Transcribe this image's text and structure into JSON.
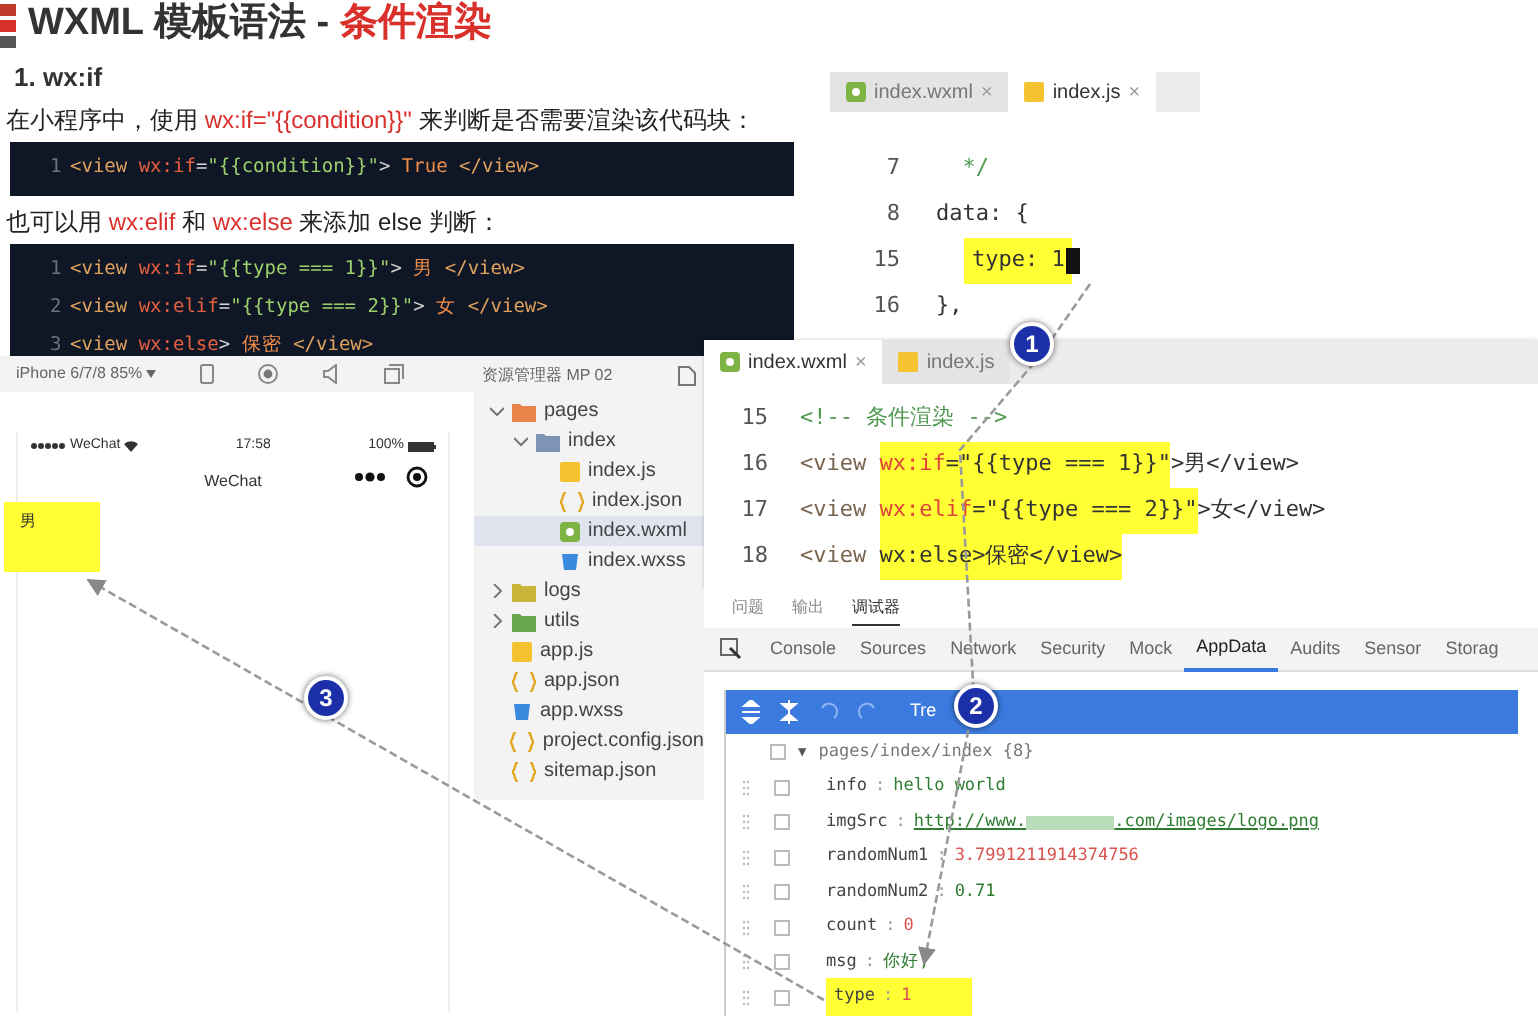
{
  "heading": {
    "title": "WXML 模板语法 - ",
    "highlight": "条件渲染"
  },
  "section_title": "1. wx:if",
  "blocks": [
    {
      "kind": "text",
      "parts": [
        {
          "kind": "plain",
          "text": "在小程序中，使用 "
        },
        {
          "kind": "code",
          "text": "wx:if=\"{{condition}}\""
        },
        {
          "kind": "plain",
          "text": " 来判断是否需要渲染该代码块："
        }
      ]
    },
    {
      "kind": "code",
      "lines": [
        {
          "number": "1",
          "tokens": [
            {
              "kind": "tag",
              "text": "<view"
            },
            {
              "kind": "attr",
              "text": " wx:if"
            },
            {
              "kind": "punct",
              "text": "="
            },
            {
              "kind": "str",
              "text": "\"{{condition}}\""
            },
            {
              "kind": "punct",
              "text": ">"
            },
            {
              "kind": "text",
              "text": " True "
            },
            {
              "kind": "tag",
              "text": "</view>"
            }
          ]
        }
      ]
    },
    {
      "kind": "text",
      "parts": [
        {
          "kind": "plain",
          "text": "也可以用 "
        },
        {
          "kind": "code",
          "text": "wx:elif"
        },
        {
          "kind": "plain",
          "text": " 和 "
        },
        {
          "kind": "code",
          "text": "wx:else"
        },
        {
          "kind": "plain",
          "text": " 来添加 else 判断："
        }
      ]
    },
    {
      "kind": "code",
      "lines": [
        {
          "number": "1",
          "tokens": [
            {
              "kind": "tag",
              "text": "<view"
            },
            {
              "kind": "attr",
              "text": " wx:if"
            },
            {
              "kind": "punct",
              "text": "="
            },
            {
              "kind": "str",
              "text": "\"{{type === 1}}\""
            },
            {
              "kind": "punct",
              "text": ">"
            },
            {
              "kind": "text",
              "text": " 男 "
            },
            {
              "kind": "tag",
              "text": "</view>"
            }
          ]
        },
        {
          "number": "2",
          "tokens": [
            {
              "kind": "tag",
              "text": "<view"
            },
            {
              "kind": "attr",
              "text": " wx:elif"
            },
            {
              "kind": "punct",
              "text": "="
            },
            {
              "kind": "str",
              "text": "\"{{type === 2}}\""
            },
            {
              "kind": "punct",
              "text": ">"
            },
            {
              "kind": "text",
              "text": " 女 "
            },
            {
              "kind": "tag",
              "text": "</view>"
            }
          ]
        },
        {
          "number": "3",
          "tokens": [
            {
              "kind": "tag",
              "text": "<view"
            },
            {
              "kind": "attr",
              "text": " wx:else"
            },
            {
              "kind": "punct",
              "text": ">"
            },
            {
              "kind": "text",
              "text": " 保密 "
            },
            {
              "kind": "tag",
              "text": "</view>"
            }
          ]
        }
      ]
    }
  ],
  "js_editor": {
    "tabs": [
      {
        "label": "index.wxml",
        "kind": "wxml",
        "close": "×",
        "selected": false
      },
      {
        "label": "index.js",
        "kind": "js",
        "close": "×",
        "selected": true
      }
    ],
    "lines": [
      {
        "number": "7",
        "cursor": false,
        "tokens": [
          {
            "kind": "comment",
            "text": "  */"
          }
        ]
      },
      {
        "number": "8",
        "cursor": false,
        "tokens": [
          {
            "kind": "plain",
            "text": "data: {"
          }
        ]
      },
      {
        "number": "15",
        "cursor": true,
        "marked": [
          {
            "kind": "plain",
            "text": "type: 1"
          }
        ]
      },
      {
        "number": "16",
        "cursor": false,
        "tokens": [
          {
            "kind": "plain",
            "text": "},"
          }
        ]
      }
    ]
  },
  "simulator": {
    "device": "iPhone 6/7/8 85%",
    "carrier": "WeChat",
    "time": "17:58",
    "battery": "100%",
    "nav_title": "WeChat",
    "page_text": "男"
  },
  "explorer": {
    "title": "资源管理器 MP 02",
    "items": [
      {
        "label": "pages",
        "kind": "folder",
        "color": "#e8834a",
        "selected": false,
        "expanded": true,
        "children": [
          {
            "label": "index",
            "kind": "folder",
            "color": "#7d93b8",
            "selected": false,
            "expanded": true,
            "children": [
              {
                "label": "index.js",
                "kind": "js",
                "selected": false
              },
              {
                "label": "index.json",
                "kind": "json",
                "selected": false
              },
              {
                "label": "index.wxml",
                "kind": "wxml",
                "selected": true
              },
              {
                "label": "index.wxss",
                "kind": "wxss",
                "selected": false
              }
            ]
          }
        ]
      },
      {
        "label": "logs",
        "kind": "folder",
        "color": "#c9b53a",
        "selected": false,
        "expanded": false
      },
      {
        "label": "utils",
        "kind": "folder",
        "color": "#6aa84f",
        "selected": false,
        "expanded": false
      },
      {
        "label": "app.js",
        "kind": "js",
        "selected": false
      },
      {
        "label": "app.json",
        "kind": "json",
        "selected": false
      },
      {
        "label": "app.wxss",
        "kind": "wxss",
        "selected": false
      },
      {
        "label": "project.config.json",
        "kind": "json",
        "selected": false
      },
      {
        "label": "sitemap.json",
        "kind": "json",
        "selected": false
      }
    ]
  },
  "wxml_editor": {
    "tabs": [
      {
        "label": "index.wxml",
        "kind": "wxml",
        "close": "×",
        "selected": true
      },
      {
        "label": "index.js",
        "kind": "js",
        "selected": false
      }
    ],
    "lines": [
      {
        "number": "15",
        "tokens": [
          {
            "kind": "comment",
            "text": "<!-- 条件渲染 -->"
          }
        ]
      },
      {
        "number": "16",
        "tokens": [
          {
            "kind": "tag",
            "text": "<view "
          }
        ],
        "marked": [
          {
            "kind": "attr",
            "text": "wx:if"
          },
          {
            "kind": "plain",
            "text": "=\"{{type === 1}}\""
          }
        ],
        "after": [
          {
            "kind": "plain",
            "text": ">男</view>"
          }
        ]
      },
      {
        "number": "17",
        "tokens": [
          {
            "kind": "tag",
            "text": "<view "
          }
        ],
        "marked": [
          {
            "kind": "attr",
            "text": "wx:elif"
          },
          {
            "kind": "plain",
            "text": "=\"{{type === 2}}\""
          }
        ],
        "after": [
          {
            "kind": "plain",
            "text": ">女</view>"
          }
        ]
      },
      {
        "number": "18",
        "tokens": [
          {
            "kind": "tag",
            "text": "<view "
          }
        ],
        "marked": [
          {
            "kind": "plain",
            "text": "wx:else>保密</view>"
          }
        ]
      }
    ]
  },
  "panel_tabs": [
    {
      "label": "问题",
      "selected": false
    },
    {
      "label": "输出",
      "selected": false
    },
    {
      "label": "调试器",
      "selected": true
    }
  ],
  "devtools_tabs": [
    {
      "label": "Console",
      "selected": false
    },
    {
      "label": "Sources",
      "selected": false
    },
    {
      "label": "Network",
      "selected": false
    },
    {
      "label": "Security",
      "selected": false
    },
    {
      "label": "Mock",
      "selected": false
    },
    {
      "label": "AppData",
      "selected": true
    },
    {
      "label": "Audits",
      "selected": false
    },
    {
      "label": "Sensor",
      "selected": false
    },
    {
      "label": "Storag",
      "selected": false
    }
  ],
  "appdata": {
    "toolbar_label": "Tre",
    "root": {
      "label": "pages/index/index {8}",
      "toggle": "▼",
      "checked": false,
      "children": [
        {
          "key": "info",
          "separator": ":",
          "value": "hello world",
          "kind": "string",
          "checked": false,
          "marked": false
        },
        {
          "key": "imgSrc",
          "separator": ":",
          "value": "http://www.",
          "value_after": ".com/images/logo.png",
          "kind": "link",
          "checked": false,
          "marked": false
        },
        {
          "key": "randomNum1",
          "separator": ":",
          "value": "3.7991211914374756",
          "kind": "number",
          "checked": false,
          "marked": false
        },
        {
          "key": "randomNum2",
          "separator": ":",
          "value": "0.71",
          "kind": "string",
          "checked": false,
          "marked": false
        },
        {
          "key": "count",
          "separator": ":",
          "value": "0",
          "kind": "number",
          "checked": false,
          "marked": false
        },
        {
          "key": "msg",
          "separator": ":",
          "value": "你好,",
          "kind": "string",
          "checked": false,
          "marked": false
        },
        {
          "key": "type",
          "separator": ":",
          "value": "1",
          "kind": "number",
          "checked": false,
          "marked": true
        }
      ]
    }
  },
  "badges": [
    "1",
    "2",
    "3"
  ]
}
